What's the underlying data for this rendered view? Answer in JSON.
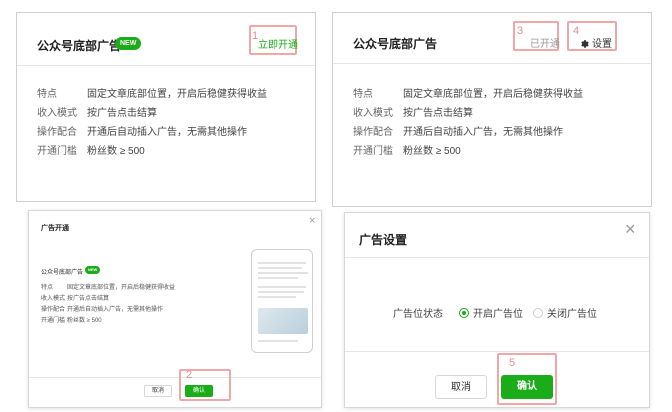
{
  "colors": {
    "accent": "#1aad19",
    "highlight": "#f1a7a7"
  },
  "card_left": {
    "title": "公众号底部广告",
    "badge": "NEW",
    "action_label": "立即开通",
    "step": "1",
    "rows": [
      {
        "k": "特点",
        "v": "固定文章底部位置，开启后稳健获得收益"
      },
      {
        "k": "收入模式",
        "v": "按广告点击结算"
      },
      {
        "k": "操作配合",
        "v": "开通后自动插入广告，无需其他操作"
      },
      {
        "k": "开通门槛",
        "v": "粉丝数 ≥ 500"
      }
    ]
  },
  "card_right": {
    "title": "公众号底部广告",
    "status_label": "已开通",
    "status_step": "3",
    "settings_label": "设置",
    "settings_step": "4",
    "rows": [
      {
        "k": "特点",
        "v": "固定文章底部位置，开启后稳健获得收益"
      },
      {
        "k": "收入模式",
        "v": "按广告点击结算"
      },
      {
        "k": "操作配合",
        "v": "开通后自动插入广告，无需其他操作"
      },
      {
        "k": "开通门槛",
        "v": "粉丝数 ≥ 500"
      }
    ]
  },
  "modal_open": {
    "title": "广告开通",
    "card_title": "公众号底部广告",
    "badge": "NEW",
    "rows": [
      {
        "k": "特点",
        "v": "固定文章底部位置，开启后稳健获得收益"
      },
      {
        "k": "收入模式",
        "v": "按广告点击结算"
      },
      {
        "k": "操作配合",
        "v": "开通后自动插入广告，无需其他操作"
      },
      {
        "k": "开通门槛",
        "v": "粉丝数 ≥ 500"
      }
    ],
    "cancel_label": "取消",
    "confirm_label": "确认",
    "step": "2"
  },
  "modal_settings": {
    "title": "广告设置",
    "field_label": "广告位状态",
    "option_on": "开启广告位",
    "option_off": "关闭广告位",
    "cancel_label": "取消",
    "confirm_label": "确认",
    "step": "5"
  }
}
